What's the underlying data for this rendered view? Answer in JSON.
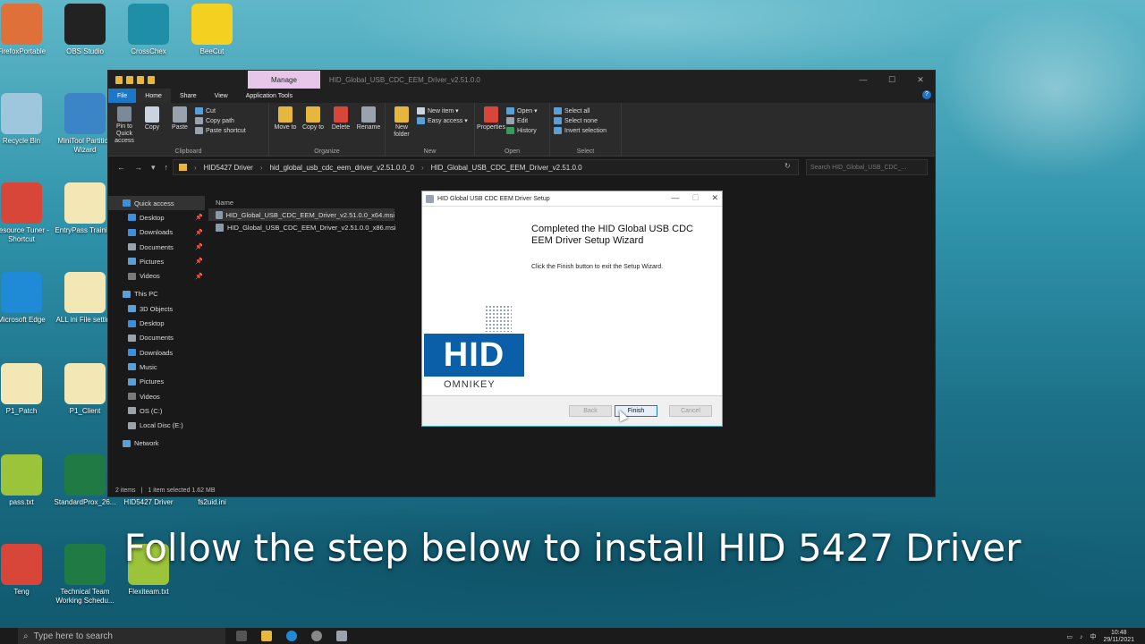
{
  "desktop": {
    "icons": [
      {
        "label": "FirefoxPortable",
        "color": "#e0703a"
      },
      {
        "label": "OBS Studio",
        "color": "#222222"
      },
      {
        "label": "CrossChex",
        "color": "#1f8fa8"
      },
      {
        "label": "BeeCut",
        "color": "#f4d020"
      },
      {
        "label": "Recycle Bin",
        "color": "#9ec6dc"
      },
      {
        "label": "MiniTool Partition Wizard",
        "color": "#3b84c6"
      },
      {
        "label": "Resource Tuner - Shortcut",
        "color": "#d8463a"
      },
      {
        "label": "EntryPass Training",
        "color": "#f3e7b5"
      },
      {
        "label": "Microsoft Edge",
        "color": "#1f8ad6"
      },
      {
        "label": "ALL ini File setting",
        "color": "#f3e7b5"
      },
      {
        "label": "P1_Patch",
        "color": "#f3e7b5"
      },
      {
        "label": "P1_Client",
        "color": "#f3e7b5"
      },
      {
        "label": "pass.txt",
        "color": "#9cc43a"
      },
      {
        "label": "StandardProx_26...",
        "color": "#1f7a44"
      },
      {
        "label": "HID5427 Driver",
        "color": "#f3e7b5"
      },
      {
        "label": "fs2uid.ini",
        "color": "#f3e7b5"
      },
      {
        "label": "Teng",
        "color": "#d8463a"
      },
      {
        "label": "Technical Team Working Schedu...",
        "color": "#1f7a44"
      },
      {
        "label": "Flexiteam.txt",
        "color": "#9cc43a"
      }
    ]
  },
  "explorer": {
    "manage_tab": "Manage",
    "window_title": "HID_Global_USB_CDC_EEM_Driver_v2.51.0.0",
    "window_controls": {
      "minimize": "—",
      "maximize": "☐",
      "close": "✕"
    },
    "ribbon_tabs": {
      "file": "File",
      "home": "Home",
      "share": "Share",
      "view": "View",
      "app_tools": "Application Tools"
    },
    "help": "?",
    "clipboard": {
      "pin": "Pin to Quick access",
      "copy": "Copy",
      "paste": "Paste",
      "cut": "Cut",
      "copy_path": "Copy path",
      "paste_shortcut": "Paste shortcut",
      "group": "Clipboard"
    },
    "organize": {
      "move_to": "Move to",
      "copy_to": "Copy to",
      "delete": "Delete",
      "rename": "Rename",
      "group": "Organize"
    },
    "new": {
      "new_folder": "New folder",
      "new_item": "New item ▾",
      "easy_access": "Easy access ▾",
      "group": "New"
    },
    "open": {
      "properties": "Properties",
      "open": "Open ▾",
      "edit": "Edit",
      "history": "History",
      "group": "Open"
    },
    "select": {
      "select_all": "Select all",
      "select_none": "Select none",
      "invert": "Invert selection",
      "group": "Select"
    },
    "address": {
      "nav_back": "←",
      "nav_forward": "→",
      "nav_recent": "▾",
      "nav_up": "↑",
      "crumbs": [
        "HID5427 Driver",
        "hid_global_usb_cdc_eem_driver_v2.51.0.0_0",
        "HID_Global_USB_CDC_EEM_Driver_v2.51.0.0"
      ],
      "separator": "›",
      "refresh": "↻",
      "search_placeholder": "Search HID_Global_USB_CDC_..."
    },
    "nav": [
      {
        "label": "Quick access",
        "color": "#3b8fe0",
        "indent": 0,
        "pinned": false
      },
      {
        "label": "Desktop",
        "color": "#3b8fe0",
        "indent": 1,
        "pinned": true
      },
      {
        "label": "Downloads",
        "color": "#3b8fe0",
        "indent": 1,
        "pinned": true
      },
      {
        "label": "Documents",
        "color": "#9aa3ad",
        "indent": 1,
        "pinned": true
      },
      {
        "label": "Pictures",
        "color": "#5aa0d8",
        "indent": 1,
        "pinned": true
      },
      {
        "label": "Videos",
        "color": "#7a7a7a",
        "indent": 1,
        "pinned": true
      },
      {
        "label": "This PC",
        "color": "#5aa0d8",
        "indent": 0,
        "pinned": false
      },
      {
        "label": "3D Objects",
        "color": "#5aa0d8",
        "indent": 1,
        "pinned": false
      },
      {
        "label": "Desktop",
        "color": "#3b8fe0",
        "indent": 1,
        "pinned": false
      },
      {
        "label": "Documents",
        "color": "#9aa3ad",
        "indent": 1,
        "pinned": false
      },
      {
        "label": "Downloads",
        "color": "#3b8fe0",
        "indent": 1,
        "pinned": false
      },
      {
        "label": "Music",
        "color": "#5aa0d8",
        "indent": 1,
        "pinned": false
      },
      {
        "label": "Pictures",
        "color": "#5aa0d8",
        "indent": 1,
        "pinned": false
      },
      {
        "label": "Videos",
        "color": "#7a7a7a",
        "indent": 1,
        "pinned": false
      },
      {
        "label": "OS (C:)",
        "color": "#9aa3ad",
        "indent": 1,
        "pinned": false
      },
      {
        "label": "Local Disc (E:)",
        "color": "#9aa3ad",
        "indent": 1,
        "pinned": false
      },
      {
        "label": "Network",
        "color": "#5aa0d8",
        "indent": 0,
        "pinned": false
      }
    ],
    "pin_glyph": "📌",
    "column_name": "Name",
    "files": [
      {
        "name": "HID_Global_USB_CDC_EEM_Driver_v2.51.0.0_x64.msi",
        "selected": true
      },
      {
        "name": "HID_Global_USB_CDC_EEM_Driver_v2.51.0.0_x86.msi",
        "selected": false
      }
    ],
    "status": {
      "count": "2 items",
      "selected": "1 item selected  1.62 MB"
    }
  },
  "dialog": {
    "title": "HID Global USB CDC EEM Driver Setup",
    "minimize": "—",
    "maximize": "☐",
    "close": "✕",
    "heading": "Completed the HID Global USB CDC EEM Driver Setup Wizard",
    "text": "Click the Finish button to exit the Setup Wizard.",
    "logo_text": "HID",
    "brand": "OMNIKEY",
    "buttons": {
      "back": "Back",
      "finish": "Finish",
      "cancel": "Cancel"
    }
  },
  "caption": "Follow the step below to install HID 5427 Driver",
  "taskbar": {
    "search_placeholder": "Type here to search",
    "clock_time": "10:48",
    "clock_date": "29/11/2021",
    "language": "中"
  }
}
